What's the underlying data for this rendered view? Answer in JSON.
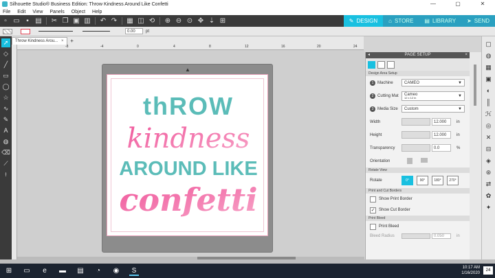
{
  "window": {
    "title": "Silhouette Studio® Business Edition: Throw Kindness Around Like Confetti",
    "controls": [
      "—",
      "▢",
      "✕"
    ]
  },
  "menu": [
    "File",
    "Edit",
    "View",
    "Panels",
    "Object",
    "Help"
  ],
  "nav_tabs": [
    {
      "label": "DESIGN",
      "icon": "pencil-icon",
      "active": true
    },
    {
      "label": "STORE",
      "icon": "store-icon",
      "active": false
    },
    {
      "label": "LIBRARY",
      "icon": "library-icon",
      "active": false
    },
    {
      "label": "SEND",
      "icon": "send-icon",
      "active": false
    }
  ],
  "prop_bar": {
    "line_width": "0.00",
    "unit": "pt"
  },
  "doc_tab": {
    "label": "Throw Kindness Arou...",
    "close": "×",
    "add": "+"
  },
  "ruler_numbers": [
    "-8",
    "-4",
    "0",
    "4",
    "8",
    "12",
    "16",
    "20",
    "24"
  ],
  "design": {
    "line1": "thROW",
    "line2": "kindness",
    "line3": "AROUND LIKE",
    "line4": "confetti",
    "colors": {
      "teal": "#5bbcb8",
      "pink": "#f0559a",
      "pink_light": "#f7a3c7"
    }
  },
  "panel": {
    "title": "PAGE SETUP",
    "section_design": "Design Area Setup",
    "machine_label": "Machine",
    "machine_value": "CAMEO",
    "mat_label": "Cutting Mat",
    "mat_value": "Cameo",
    "mat_sub": "12 x 12 in",
    "media_label": "Media Size",
    "media_value": "Custom",
    "width_label": "Width",
    "width_value": "12.000",
    "height_label": "Height",
    "height_value": "12.000",
    "unit_in": "in",
    "transparency_label": "Transparency",
    "transparency_value": "0.0",
    "unit_pct": "%",
    "orientation_label": "Orientation",
    "section_rotate": "Rotate View",
    "rotate_label": "Rotate",
    "rotate_options": [
      "0°",
      "90°",
      "180°",
      "270°"
    ],
    "section_borders": "Print and Cut Borders",
    "show_print_border": "Show Print Border",
    "show_cut_border": "Show Cut Border",
    "section_bleed": "Print Bleed",
    "print_bleed": "Print Bleed",
    "bleed_radius": "Bleed Radius",
    "bleed_value": "0.050",
    "unit_in2": "in"
  },
  "taskbar": {
    "time": "10:17 AM",
    "date": "1/16/2020",
    "notifications": "24"
  }
}
